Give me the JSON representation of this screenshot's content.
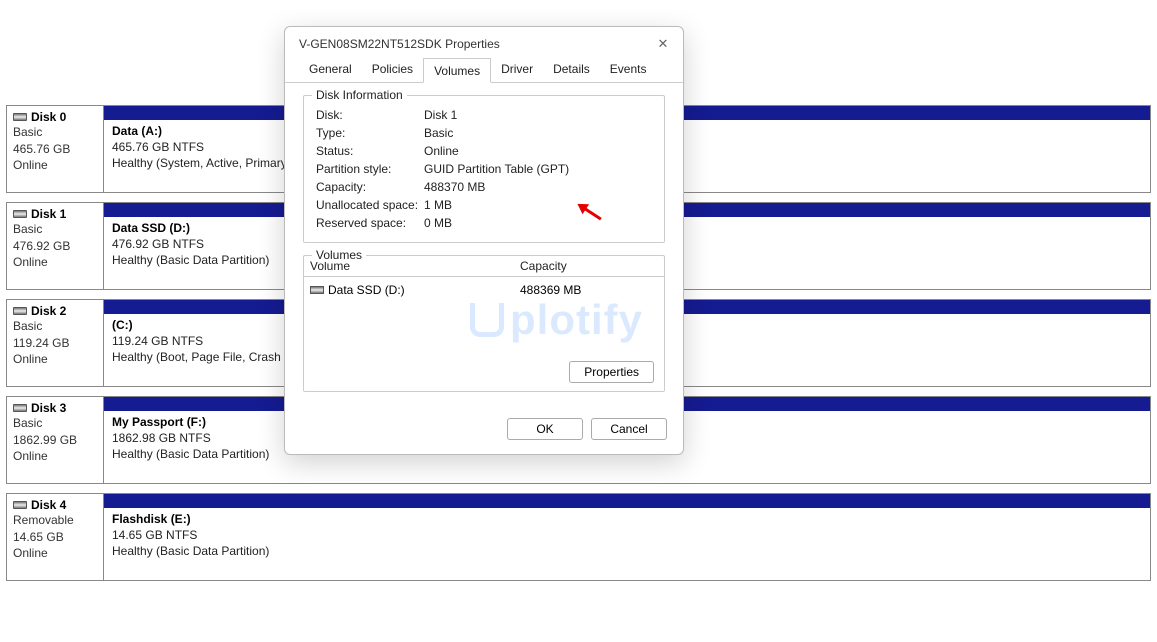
{
  "dialog": {
    "title": "V-GEN08SM22NT512SDK Properties",
    "tabs": [
      "General",
      "Policies",
      "Volumes",
      "Driver",
      "Details",
      "Events"
    ],
    "active_tab_index": 2,
    "disk_info": {
      "group_label": "Disk Information",
      "rows": [
        {
          "label": "Disk:",
          "value": "Disk 1"
        },
        {
          "label": "Type:",
          "value": "Basic"
        },
        {
          "label": "Status:",
          "value": "Online"
        },
        {
          "label": "Partition style:",
          "value": "GUID Partition Table (GPT)"
        },
        {
          "label": "Capacity:",
          "value": "488370 MB"
        },
        {
          "label": "Unallocated space:",
          "value": "1 MB"
        },
        {
          "label": "Reserved space:",
          "value": "0 MB"
        }
      ]
    },
    "volumes_group": {
      "group_label": "Volumes",
      "headers": {
        "col1": "Volume",
        "col2": "Capacity"
      },
      "rows": [
        {
          "name": "Data SSD (D:)",
          "capacity": "488369 MB"
        }
      ],
      "properties_button": "Properties"
    },
    "footer": {
      "ok": "OK",
      "cancel": "Cancel"
    }
  },
  "disks": [
    {
      "name": "Disk 0",
      "type": "Basic",
      "size": "465.76 GB",
      "state": "Online",
      "volume": {
        "name": "Data  (A:)",
        "size": "465.76 GB NTFS",
        "status": "Healthy (System, Active, Primary Partition)"
      }
    },
    {
      "name": "Disk 1",
      "type": "Basic",
      "size": "476.92 GB",
      "state": "Online",
      "volume": {
        "name": "Data SSD  (D:)",
        "size": "476.92 GB NTFS",
        "status": "Healthy (Basic Data Partition)"
      }
    },
    {
      "name": "Disk 2",
      "type": "Basic",
      "size": "119.24 GB",
      "state": "Online",
      "volume": {
        "name": "(C:)",
        "size": "119.24 GB NTFS",
        "status": "Healthy (Boot, Page File, Crash Dump, Basic Data Partition)"
      }
    },
    {
      "name": "Disk 3",
      "type": "Basic",
      "size": "1862.99 GB",
      "state": "Online",
      "volume": {
        "name": "My Passport  (F:)",
        "size": "1862.98 GB NTFS",
        "status": "Healthy (Basic Data Partition)"
      }
    },
    {
      "name": "Disk 4",
      "type": "Removable",
      "size": "14.65 GB",
      "state": "Online",
      "volume": {
        "name": "Flashdisk  (E:)",
        "size": "14.65 GB NTFS",
        "status": "Healthy (Basic Data Partition)"
      }
    }
  ],
  "watermark_text": "plotify"
}
